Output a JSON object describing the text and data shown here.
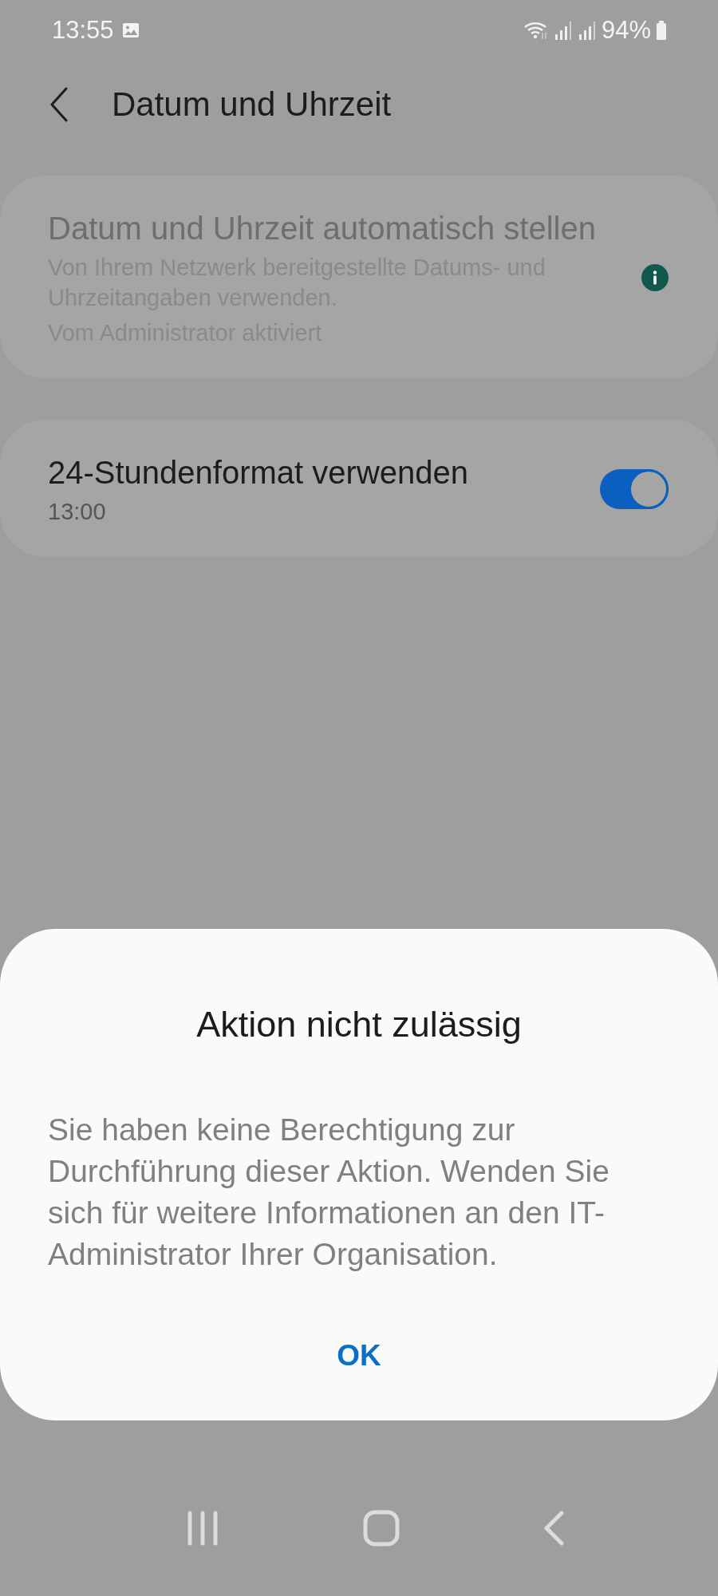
{
  "status_bar": {
    "time": "13:55",
    "battery": "94%"
  },
  "header": {
    "title": "Datum und Uhrzeit"
  },
  "settings": [
    {
      "kind": "info",
      "title": "Datum und Uhrzeit automatisch stellen",
      "summary": "Von Ihrem Netzwerk bereitgestellte Datums- und Uhrzeitangaben verwenden.",
      "note": "Vom Administrator aktiviert",
      "disabled": true
    },
    {
      "kind": "switch",
      "title": "24-Stundenformat verwenden",
      "summary": "13:00",
      "on": true,
      "disabled": false
    }
  ],
  "dialog": {
    "title": "Aktion nicht zulässig",
    "message": "Sie haben keine Berechtigung zur Durchführung dieser Aktion. Wenden Sie sich für weitere Informationen an den IT-Administrator Ihrer Organisation.",
    "button": "OK"
  }
}
